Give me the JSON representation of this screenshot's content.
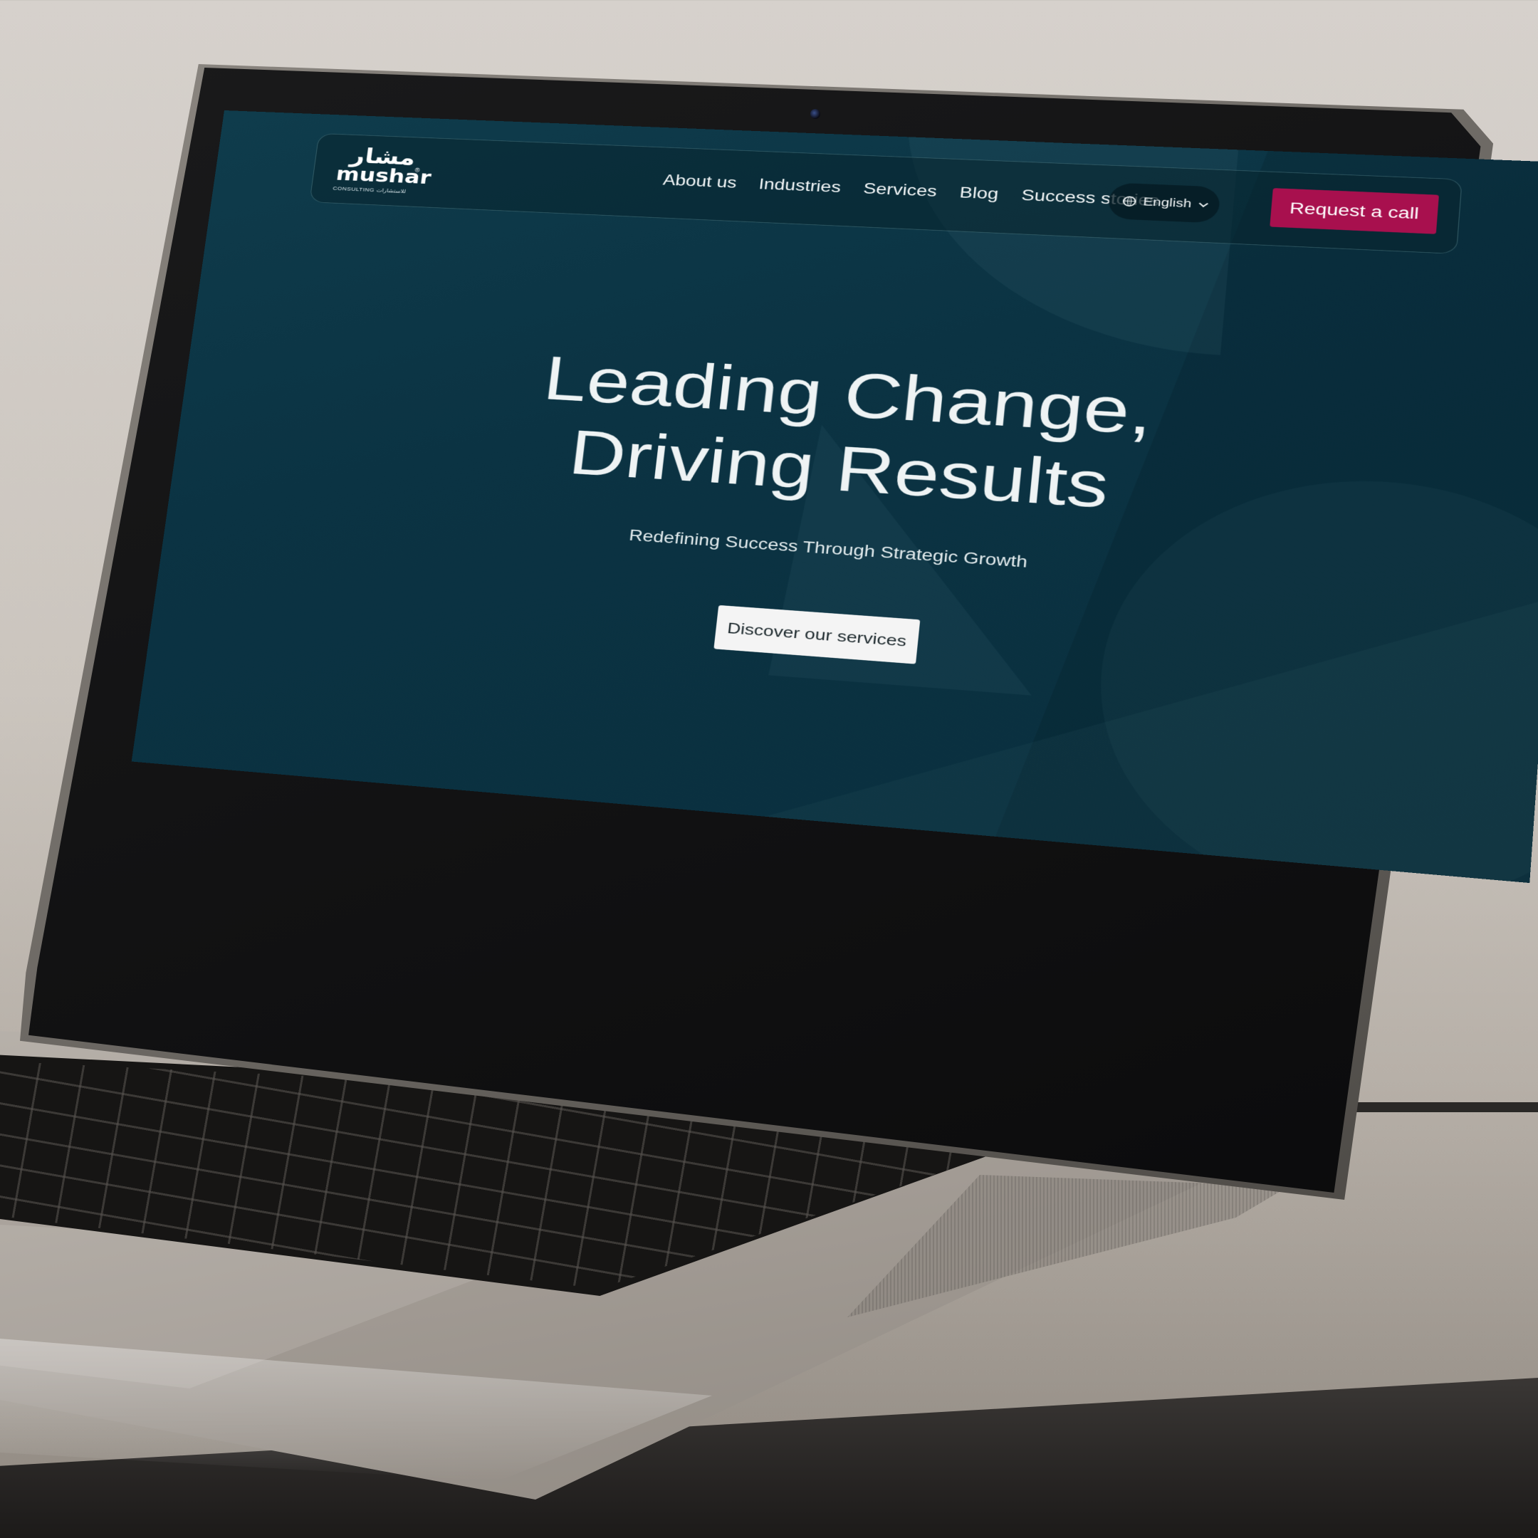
{
  "brand": {
    "logo_arabic": "مشار",
    "logo_name": "mushar",
    "logo_reg": "®",
    "logo_sub": "CONSULTING للاستشارات"
  },
  "nav": {
    "items": [
      {
        "label": "About us"
      },
      {
        "label": "Industries"
      },
      {
        "label": "Services"
      },
      {
        "label": "Blog"
      },
      {
        "label": "Success stories"
      }
    ],
    "language": "English",
    "cta_label": "Request a call"
  },
  "hero": {
    "title_line1": "Leading Change,",
    "title_line2": "Driving Results",
    "subtitle": "Redefining Success Through Strategic Growth",
    "button_label": "Discover our services"
  },
  "icons": {
    "language": "globe-icon",
    "dropdown": "chevron-down-icon"
  },
  "colors": {
    "background": "#0b3343",
    "accent": "#a8104e",
    "text": "#eef3f4"
  }
}
